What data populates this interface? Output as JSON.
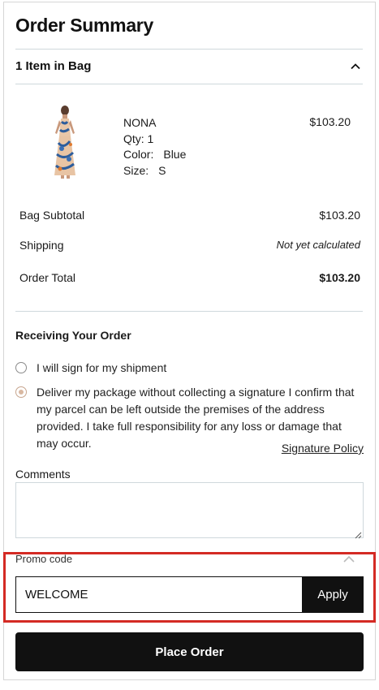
{
  "header": {
    "title": "Order Summary"
  },
  "bag": {
    "label": "1 Item in Bag",
    "toggle_icon": "chevron-up-icon",
    "item": {
      "image": "dress-product-image",
      "name": "NONA",
      "qty": "Qty: 1",
      "color_label": "Color:",
      "color_value": "Blue",
      "size_label": "Size:",
      "size_value": "S",
      "price": "$103.20"
    }
  },
  "summary": {
    "subtotal_label": "Bag Subtotal",
    "subtotal_value": "$103.20",
    "shipping_label": "Shipping",
    "shipping_value": "Not yet calculated",
    "total_label": "Order Total",
    "total_value": "$103.20"
  },
  "receiving": {
    "heading": "Receiving Your Order",
    "options": [
      {
        "label": "I will sign for my shipment",
        "checked": false
      },
      {
        "label": "Deliver my package without collecting a signature I confirm that my parcel can be left outside the premises of the address provided. I take full responsibility for any loss or damage that may occur.",
        "checked": true
      }
    ],
    "policy_link": "Signature Policy"
  },
  "comments": {
    "label": "Comments",
    "value": ""
  },
  "promo": {
    "label": "Promo code",
    "toggle_icon": "chevron-up-icon",
    "value": "WELCOME",
    "apply_label": "Apply"
  },
  "actions": {
    "place_order": "Place Order"
  },
  "colors": {
    "highlight": "#d42a24",
    "button": "#111111",
    "radio_selected": "#d9b8a1",
    "divider": "#cfd8dc"
  }
}
